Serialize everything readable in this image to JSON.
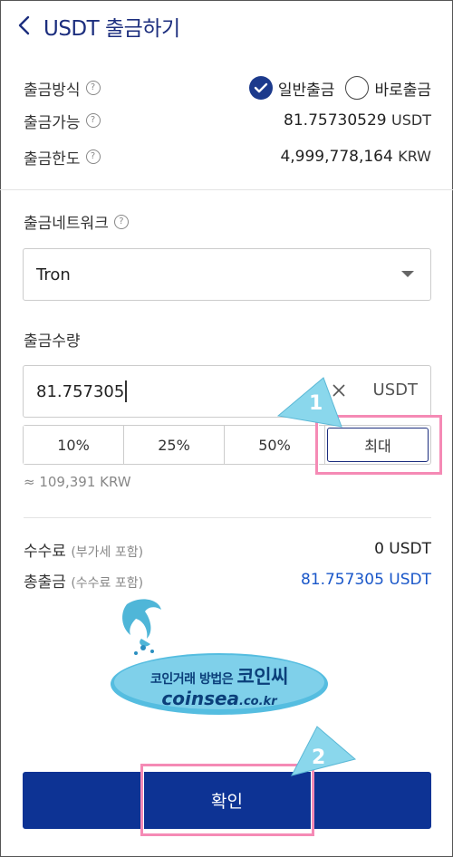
{
  "header": {
    "title": "USDT 출금하기"
  },
  "method": {
    "label": "출금방식",
    "options": [
      "일반출금",
      "바로출금"
    ],
    "selected": "일반출금"
  },
  "available": {
    "label": "출금가능",
    "amount": "81.75730529",
    "unit": "USDT"
  },
  "limit": {
    "label": "출금한도",
    "amount": "4,999,778,164",
    "unit": "KRW"
  },
  "network": {
    "label": "출금네트워크",
    "selected": "Tron"
  },
  "quantity": {
    "label": "출금수량",
    "value": "81.757305",
    "unit": "USDT",
    "percent_buttons": [
      "10%",
      "25%",
      "50%",
      "최대"
    ],
    "approx_krw": "≈ 109,391 KRW"
  },
  "fee": {
    "label": "수수료",
    "note": "(부가세 포함)",
    "value": "0 USDT"
  },
  "total": {
    "label": "총출금",
    "note": "(수수료 포함)",
    "value": "81.757305 USDT"
  },
  "confirm_label": "확인",
  "annotations": {
    "step1": "1",
    "step2": "2"
  },
  "watermark": {
    "line1": "코인거래 방법은",
    "brand": "코인씨",
    "domain": "coinsea",
    "tld": ".co.kr"
  },
  "colors": {
    "primary": "#0d3394",
    "accent_blue": "#1a57c9",
    "highlight": "#f58ab5",
    "badge": "#7fd3e8"
  },
  "icons": {
    "back": "chevron-left-icon",
    "help": "question-circle-icon",
    "check": "check-icon",
    "clear": "close-icon",
    "dropdown": "caret-down-icon"
  }
}
